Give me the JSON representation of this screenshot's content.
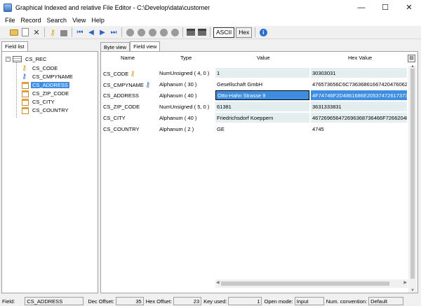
{
  "window": {
    "title": "Graphical Indexed and relative File Editor - C:\\Develop\\data\\customer"
  },
  "titlebar": {
    "minimize": "—",
    "maximize": "☐",
    "close": "✕"
  },
  "menu": [
    "File",
    "Record",
    "Search",
    "View",
    "Help"
  ],
  "toolbar": {
    "ascii_label": "ASCII",
    "hex_label": "Hex"
  },
  "left": {
    "tab": "Field list",
    "root": "CS_REC",
    "items": [
      {
        "label": "CS_CODE",
        "icon": "key-yellow-icon"
      },
      {
        "label": "CS_CMPYNAME",
        "icon": "key-blue-icon"
      },
      {
        "label": "CS_ADDRESS",
        "icon": "field-icon",
        "selected": true
      },
      {
        "label": "CS_ZIP_CODE",
        "icon": "field-icon"
      },
      {
        "label": "CS_CITY",
        "icon": "field-icon"
      },
      {
        "label": "CS_COUNTRY",
        "icon": "field-icon"
      }
    ]
  },
  "right": {
    "tabs": [
      "Byte view",
      "Field view"
    ],
    "active_tab": "Field view",
    "headers": {
      "name": "Name",
      "type": "Type",
      "value": "Value",
      "hex": "Hex Value"
    },
    "rows": [
      {
        "name": "CS_CODE",
        "type": "NumUnsigned ( 4, 0 )",
        "value": "1",
        "hex": "30303031",
        "key": "yellow"
      },
      {
        "name": "CS_CMPYNAME",
        "type": "Alphanum ( 30 )",
        "value": "Gesellschaft GmbH",
        "hex": "476573656C6C736368616674204760624",
        "key": "blue"
      },
      {
        "name": "CS_ADDRESS",
        "type": "Alphanum ( 40 )",
        "value": "Otto-Hahn Strasse 9",
        "hex": "4F74746F2D4861686E205374726173736",
        "selected": true
      },
      {
        "name": "CS_ZIP_CODE",
        "type": "NumUnsigned ( 5, 0 )",
        "value": "61381",
        "hex": "3631333831"
      },
      {
        "name": "CS_CITY",
        "type": "Alphanum ( 40 )",
        "value": "Friedrichsdorf Koeppern",
        "hex": "467269656472696368736466F7266204B6"
      },
      {
        "name": "CS_COUNTRY",
        "type": "Alphanum ( 2 )",
        "value": "GE",
        "hex": "4745"
      }
    ]
  },
  "status": {
    "field_label": "Field:",
    "field_value": "CS_ADDRESS",
    "dec_label": "Dec Offset:",
    "dec_value": "35",
    "hex_label": "Hex Offset:",
    "hex_value": "23",
    "key_label": "Key used:",
    "key_value": "1",
    "open_label": "Open mode:",
    "open_value": "Input",
    "num_label": "Num. convention:",
    "num_value": "Default"
  }
}
